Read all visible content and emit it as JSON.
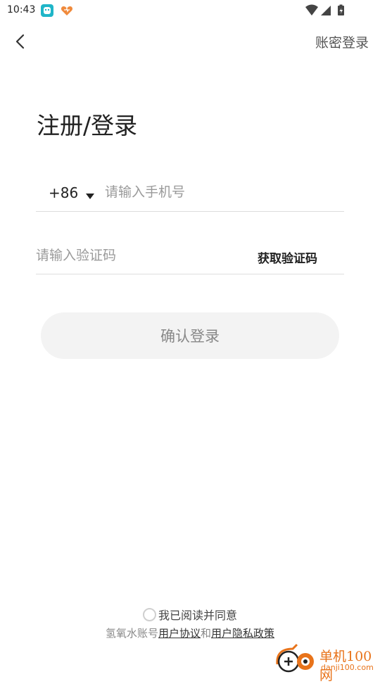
{
  "status_bar": {
    "time": "10:43"
  },
  "header": {
    "top_right_link": "账密登录"
  },
  "main": {
    "title": "注册/登录",
    "phone": {
      "country_code": "+86",
      "placeholder": "请输入手机号",
      "value": ""
    },
    "code": {
      "placeholder": "请输入验证码",
      "value": "",
      "get_code_label": "获取验证码"
    },
    "confirm_label": "确认登录"
  },
  "footer": {
    "agree_text": "我已阅读并同意",
    "terms_prefix": "氢氧水账号",
    "user_agreement": "用户协议",
    "and_text": "和",
    "privacy_policy": "用户隐私政策"
  },
  "watermark": {
    "main": "单机100网",
    "sub": "danji100.com"
  },
  "colors": {
    "accent": "#e8731a",
    "button_bg": "#f3f3f3",
    "divider": "#dddddd"
  }
}
